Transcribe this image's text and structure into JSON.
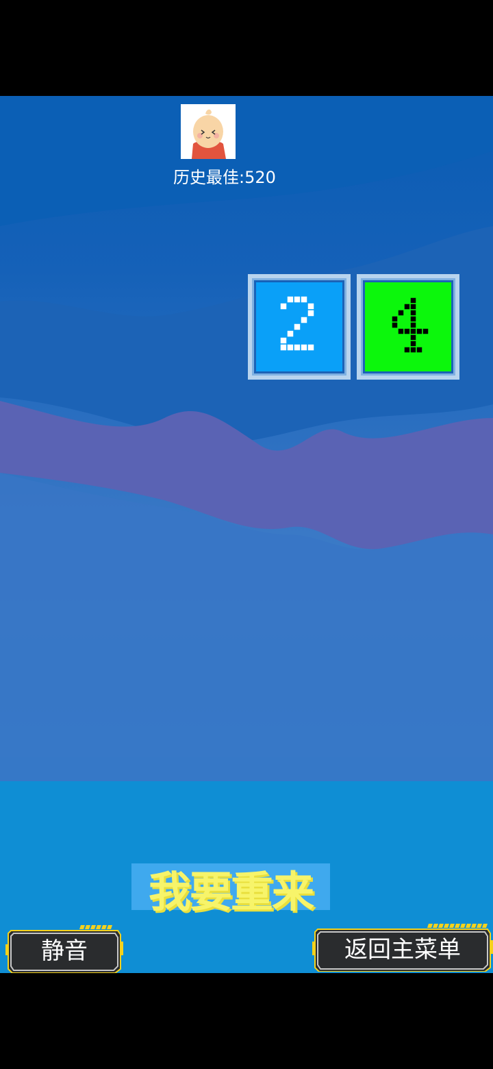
{
  "header": {
    "avatar_icon": "egg-character-avatar",
    "best_score_label": "历史最佳:520"
  },
  "board": {
    "tiles": [
      {
        "value": "2",
        "color": "#0aa0f8",
        "digit_color": "#ffffff"
      },
      {
        "value": "4",
        "color": "#0cf70c",
        "digit_color": "#000000"
      }
    ]
  },
  "actions": {
    "restart_label": "我要重来",
    "mute_label": "静音",
    "main_menu_label": "返回主菜单"
  },
  "colors": {
    "restart_text": "#f7f46a",
    "button_bg": "#2a2c2e",
    "button_accent": "#f5d21c"
  }
}
